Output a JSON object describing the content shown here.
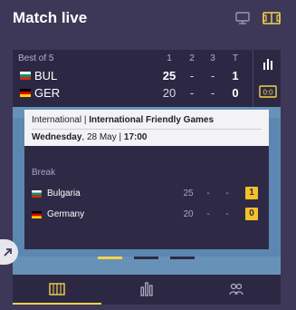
{
  "header": {
    "title": "Match live",
    "icons": [
      "monitor-icon",
      "pitch-icon"
    ]
  },
  "scoreboard": {
    "format": "Best of 5",
    "columns": [
      "1",
      "2",
      "3",
      "T"
    ],
    "teams": [
      {
        "code": "BUL",
        "flag": "bulgaria-flag",
        "sets": [
          "25",
          "-",
          "-"
        ],
        "total": "1"
      },
      {
        "code": "GER",
        "flag": "germany-flag",
        "sets": [
          "20",
          "-",
          "-"
        ],
        "total": "0"
      }
    ],
    "side_icons": [
      "stats-icon",
      "scoreboard-icon"
    ],
    "side_scoreboard_text": "0:0"
  },
  "popup": {
    "category": "International",
    "separator": "|",
    "competition": "International Friendly Games",
    "weekday": "Wednesday",
    "date": ", 28 May",
    "time": "17:00",
    "status": "Break",
    "teams": [
      {
        "name": "Bulgaria",
        "flag": "bulgaria-flag",
        "sets": [
          "25",
          "-",
          "-"
        ],
        "total": "1"
      },
      {
        "name": "Germany",
        "flag": "germany-flag",
        "sets": [
          "20",
          "-",
          "-"
        ],
        "total": "0"
      }
    ]
  },
  "carousel": {
    "count": 3,
    "active_index": 0
  },
  "bottom_nav": {
    "tabs": [
      "pitch-tab",
      "stats-tab",
      "lineups-tab"
    ],
    "active_index": 0
  },
  "colors": {
    "accent": "#f4d44a",
    "background": "#3d3858",
    "panel": "#2c2844",
    "field": "#5c87b0"
  }
}
